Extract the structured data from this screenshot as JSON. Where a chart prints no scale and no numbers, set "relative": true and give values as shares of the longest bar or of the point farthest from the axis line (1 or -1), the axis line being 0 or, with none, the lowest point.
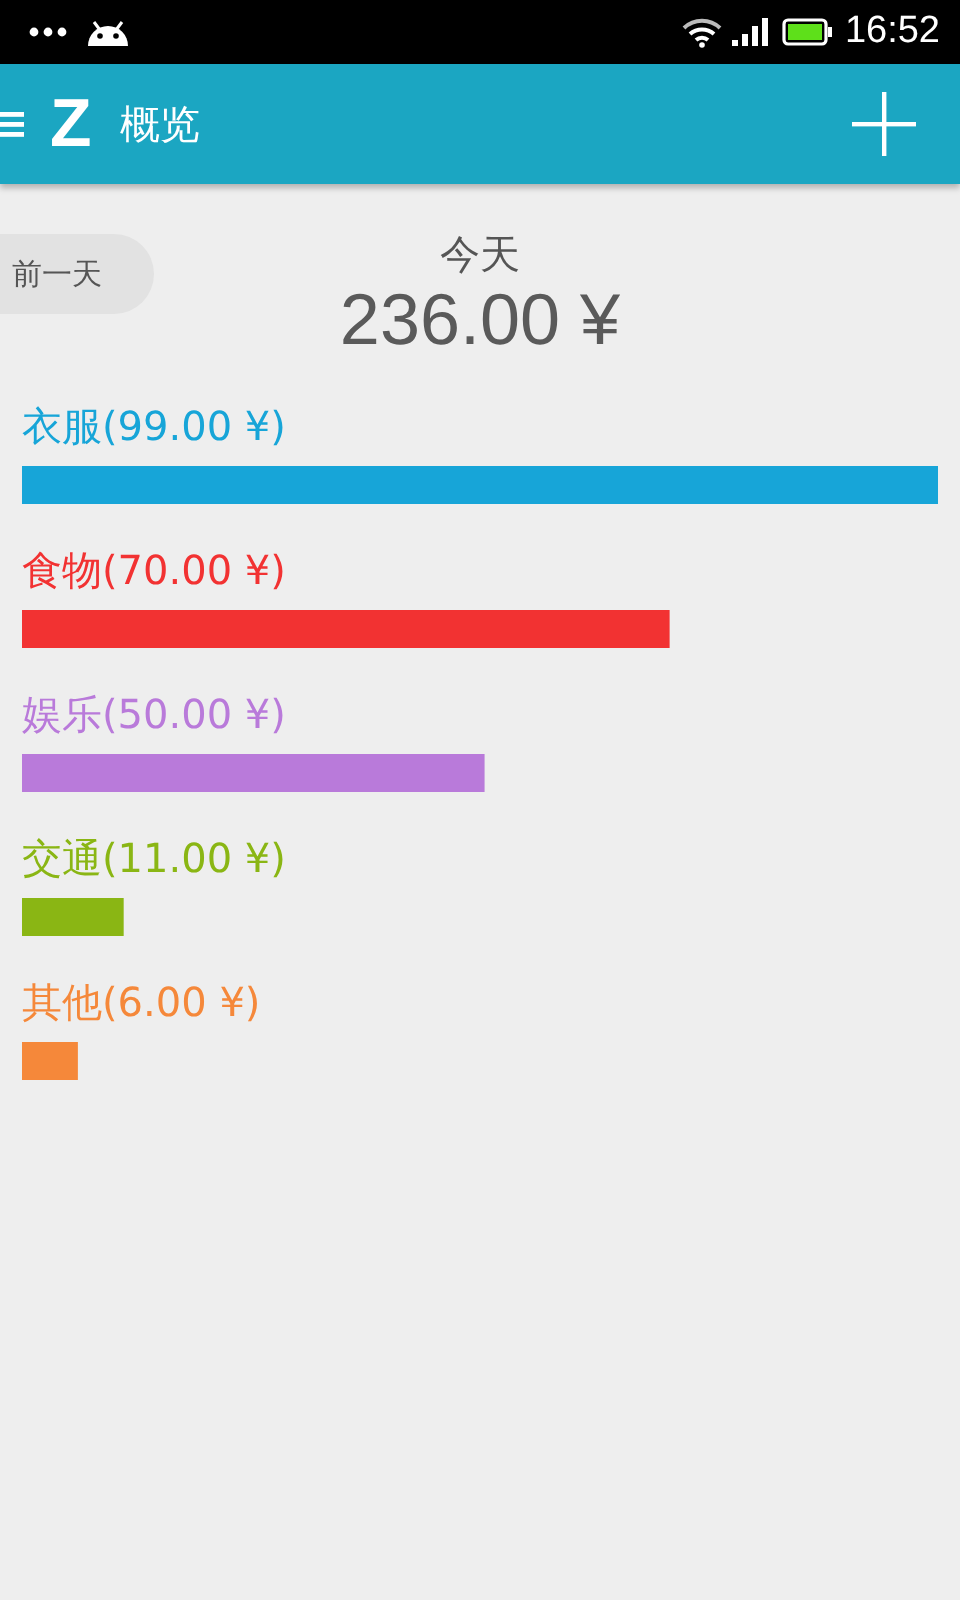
{
  "status_bar": {
    "time": "16:52"
  },
  "app_bar": {
    "logo": "Z",
    "title": "概览"
  },
  "header": {
    "prev_button": "前一天",
    "day": "今天",
    "total": "236.00 ¥"
  },
  "breakdown": {
    "items": [
      {
        "color": "#17a5d8"
      },
      {
        "color": "#f23232"
      },
      {
        "color": "#b97ada"
      },
      {
        "color": "#8ab614"
      },
      {
        "color": "#f5883a"
      }
    ],
    "chart_data": {
      "type": "bar",
      "orientation": "horizontal",
      "relative": true,
      "categories": [
        "衣服(99.00 ¥)",
        "食物(70.00 ¥)",
        "娱乐(50.00 ¥)",
        "交通(11.00 ¥)",
        "其他(6.00 ¥)"
      ],
      "values": [
        1,
        0.707,
        0.505,
        0.111,
        0.061
      ]
    }
  }
}
